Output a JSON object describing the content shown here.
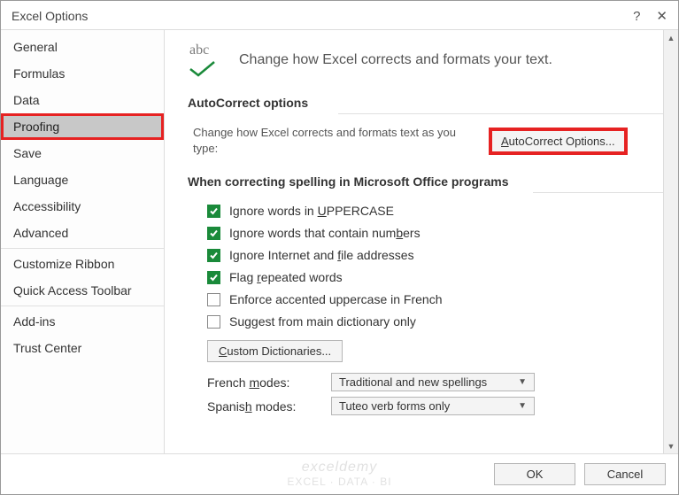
{
  "window": {
    "title": "Excel Options"
  },
  "sidebar": {
    "items": [
      {
        "label": "General"
      },
      {
        "label": "Formulas"
      },
      {
        "label": "Data"
      },
      {
        "label": "Proofing",
        "selected": true,
        "highlighted": true
      },
      {
        "label": "Save"
      },
      {
        "label": "Language"
      },
      {
        "label": "Accessibility"
      },
      {
        "label": "Advanced"
      },
      {
        "label": "Customize Ribbon"
      },
      {
        "label": "Quick Access Toolbar"
      },
      {
        "label": "Add-ins"
      },
      {
        "label": "Trust Center"
      }
    ]
  },
  "header": {
    "icon_text": "abc",
    "text": "Change how Excel corrects and formats your text."
  },
  "autocorrect": {
    "title": "AutoCorrect options",
    "desc": "Change how Excel corrects and formats text as you type:",
    "button_prefix": "A",
    "button_rest": "utoCorrect Options..."
  },
  "spelling": {
    "title": "When correcting spelling in Microsoft Office programs",
    "checks": [
      {
        "checked": true,
        "pre": "Ignore words in ",
        "u": "U",
        "post": "PPERCASE"
      },
      {
        "checked": true,
        "pre": "Ignore words that contain num",
        "u": "b",
        "post": "ers"
      },
      {
        "checked": true,
        "pre": "Ignore Internet and ",
        "u": "f",
        "post": "ile addresses"
      },
      {
        "checked": true,
        "pre": "Flag ",
        "u": "r",
        "post": "epeated words"
      },
      {
        "checked": false,
        "pre": "Enforce accented uppercase in French",
        "u": "",
        "post": ""
      },
      {
        "checked": false,
        "pre": "Suggest from main dictionary only",
        "u": "",
        "post": ""
      }
    ],
    "dict_button_u": "C",
    "dict_button_rest": "ustom Dictionaries...",
    "french_label_pre": "French ",
    "french_label_u": "m",
    "french_label_post": "odes:",
    "french_value": "Traditional and new spellings",
    "spanish_label_pre": "Spanis",
    "spanish_label_u": "h",
    "spanish_label_post": " modes:",
    "spanish_value": "Tuteo verb forms only"
  },
  "footer": {
    "ok": "OK",
    "cancel": "Cancel"
  },
  "watermark": {
    "line1": "exceldemy",
    "line2": "EXCEL · DATA · BI"
  }
}
